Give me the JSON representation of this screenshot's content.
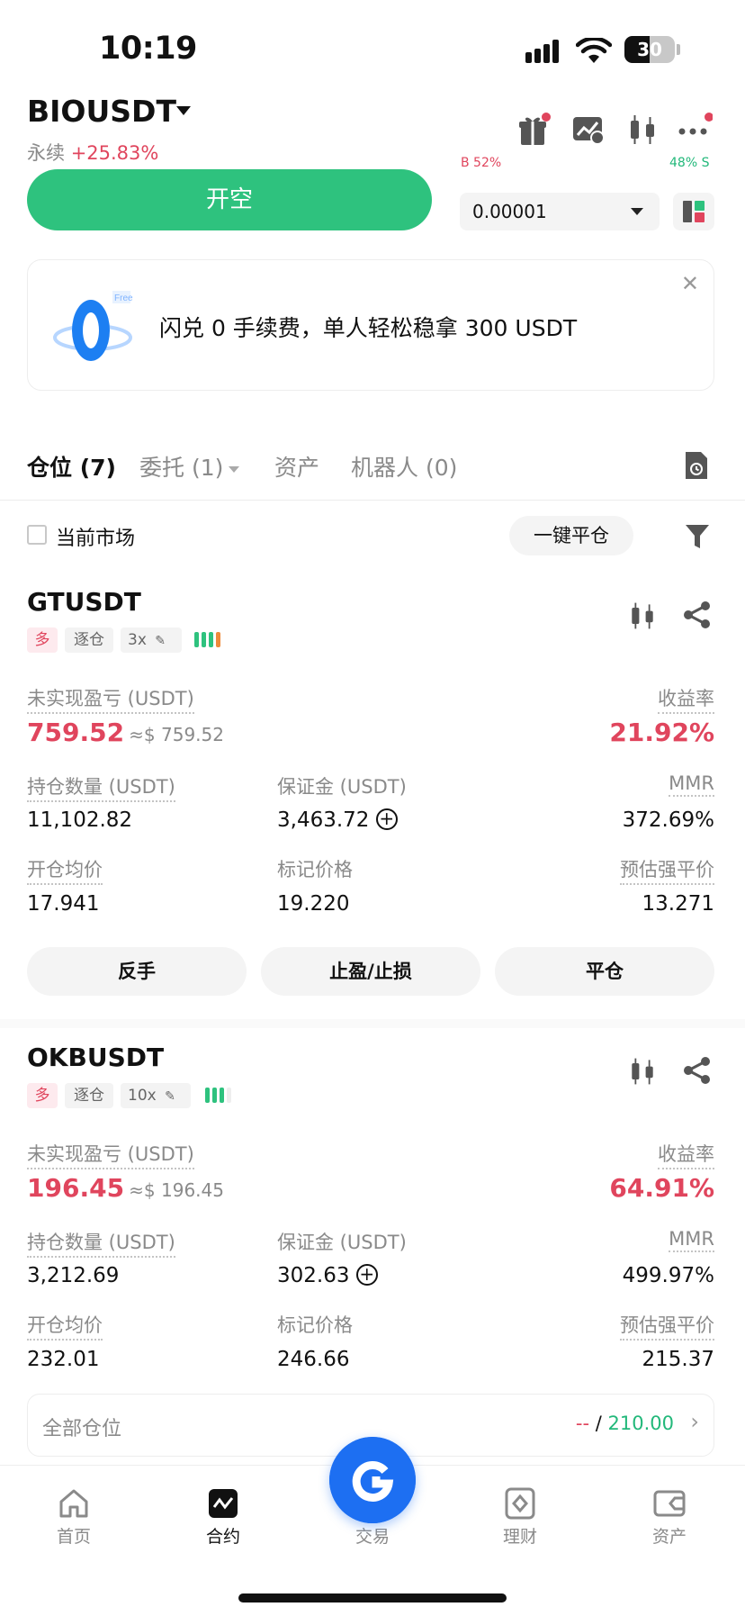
{
  "status_bar": {
    "time": "10:19",
    "battery": "30"
  },
  "header": {
    "symbol": "BIOUSDT",
    "contract_type": "永续",
    "change": "+25.83%"
  },
  "order_panel": {
    "short_button": "开空",
    "price_step": "0.00001",
    "cut_left": "B 52%",
    "cut_right": "48% S"
  },
  "banner": {
    "title": "闪兑 0 手续费，单人轻松稳拿 300 USDT",
    "logo_text": "Free"
  },
  "tabs": [
    {
      "label": "仓位 (7)"
    },
    {
      "label": "委托 (1)"
    },
    {
      "label": "资产"
    },
    {
      "label": "机器人 (0)"
    }
  ],
  "filter": {
    "current_market_label": "当前市场",
    "close_all_label": "一键平仓"
  },
  "labels": {
    "unrealized_pnl": "未实现盈亏 (USDT)",
    "roi": "收益率",
    "position_size": "持仓数量 (USDT)",
    "margin": "保证金 (USDT)",
    "mmr": "MMR",
    "entry_price": "开仓均价",
    "mark_price": "标记价格",
    "liq_price": "预估强平价",
    "reverse": "反手",
    "tp_sl": "止盈/止损",
    "close": "平仓"
  },
  "positions": [
    {
      "symbol": "GTUSDT",
      "side": "多",
      "margin_mode": "逐仓",
      "leverage": "3x",
      "pnl": "759.52",
      "pnl_approx": "≈$ 759.52",
      "roi": "21.92%",
      "size": "11,102.82",
      "margin": "3,463.72",
      "mmr": "372.69%",
      "entry": "17.941",
      "mark": "19.220",
      "liq": "13.271",
      "risk_bars": [
        "#2ec27e",
        "#2ec27e",
        "#2ec27e",
        "#ee8a3b"
      ]
    },
    {
      "symbol": "OKBUSDT",
      "side": "多",
      "margin_mode": "逐仓",
      "leverage": "10x",
      "pnl": "196.45",
      "pnl_approx": "≈$ 196.45",
      "roi": "64.91%",
      "size": "3,212.69",
      "margin": "302.63",
      "mmr": "499.97%",
      "entry": "232.01",
      "mark": "246.66",
      "liq": "215.37",
      "risk_bars": [
        "#2ec27e",
        "#2ec27e",
        "#2ec27e",
        "#eeeeee"
      ]
    }
  ],
  "summary": {
    "label": "全部仓位",
    "left_value": "--",
    "sep": "/",
    "right_value": "210.00"
  },
  "bottom_nav": [
    {
      "label": "首页",
      "icon": "home-icon"
    },
    {
      "label": "合约",
      "icon": "futures-icon"
    },
    {
      "label": "交易",
      "icon": "trade-icon"
    },
    {
      "label": "理财",
      "icon": "earn-icon"
    },
    {
      "label": "资产",
      "icon": "wallet-icon"
    }
  ],
  "colors": {
    "green": "#2ec27e",
    "red": "#e0455d",
    "orange": "#ee8a3b",
    "brand_blue": "#1d6ff2"
  }
}
